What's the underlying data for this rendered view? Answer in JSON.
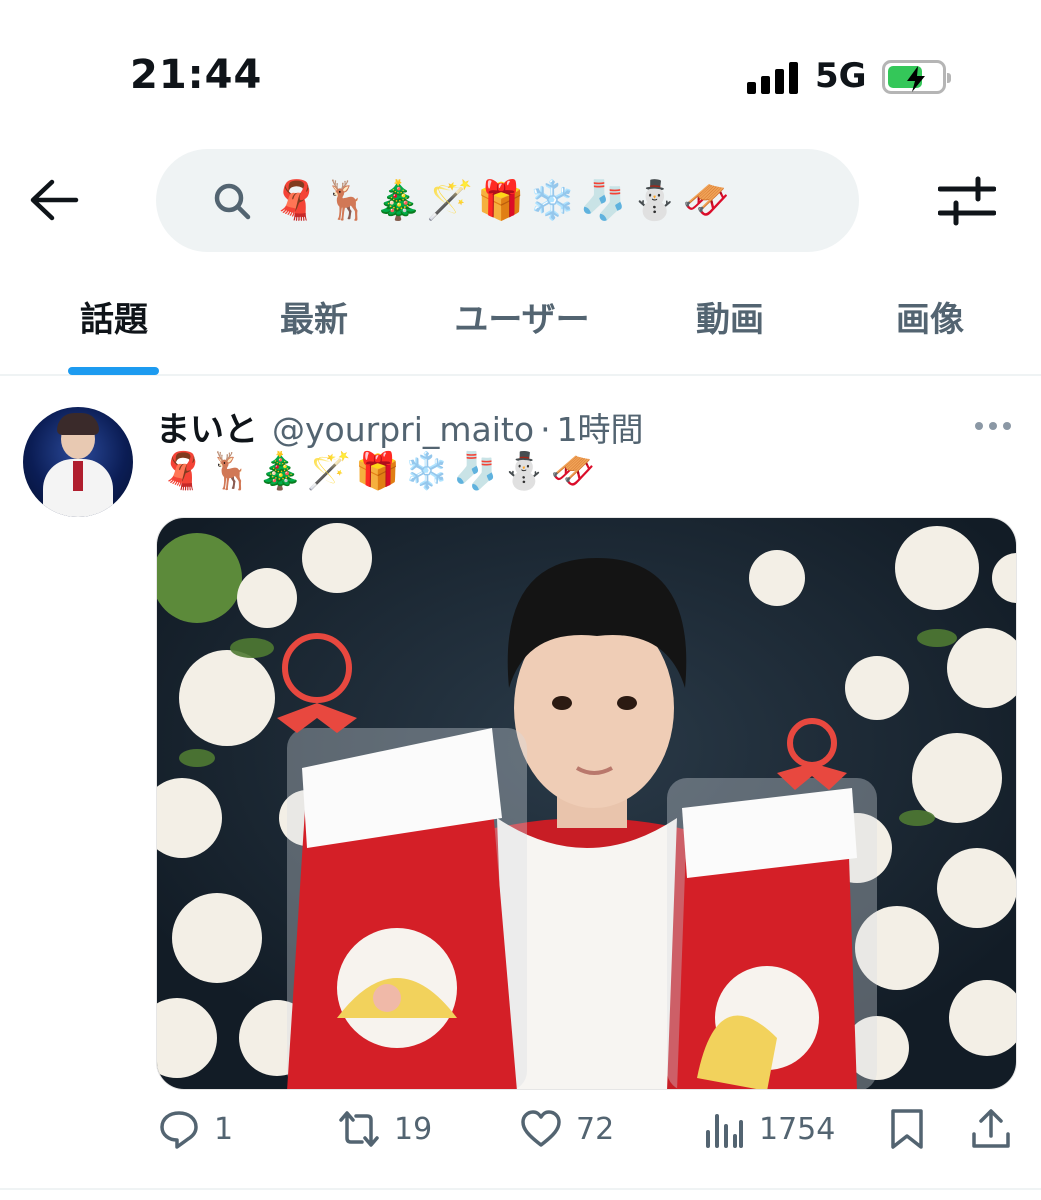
{
  "status_bar": {
    "time": "21:44",
    "network": "5G",
    "battery_charging": true
  },
  "search": {
    "query": "🧣🦌🎄🪄🎁❄️🧦⛄🛷"
  },
  "tabs": [
    {
      "label": "話題",
      "active": true
    },
    {
      "label": "最新",
      "active": false
    },
    {
      "label": "ユーザー",
      "active": false
    },
    {
      "label": "動画",
      "active": false
    },
    {
      "label": "画像",
      "active": false
    }
  ],
  "tweet": {
    "display_name": "まいと",
    "handle": "@yourpri_maito",
    "separator": "·",
    "time": "1時間",
    "text": "🧣🦌🎄🪄🎁❄️🧦⛄🛷",
    "replies": "1",
    "retweets": "19",
    "likes": "72",
    "views": "1754"
  },
  "colors": {
    "accent": "#1d9bf0",
    "secondary_text": "#536471",
    "primary_text": "#0f1419",
    "search_bg": "#eff3f4"
  },
  "icons": [
    "arrow-left-icon",
    "search-icon",
    "filter-sliders-icon",
    "more-dots-icon",
    "reply-icon",
    "retweet-icon",
    "heart-icon",
    "views-chart-icon",
    "bookmark-icon",
    "share-icon"
  ]
}
